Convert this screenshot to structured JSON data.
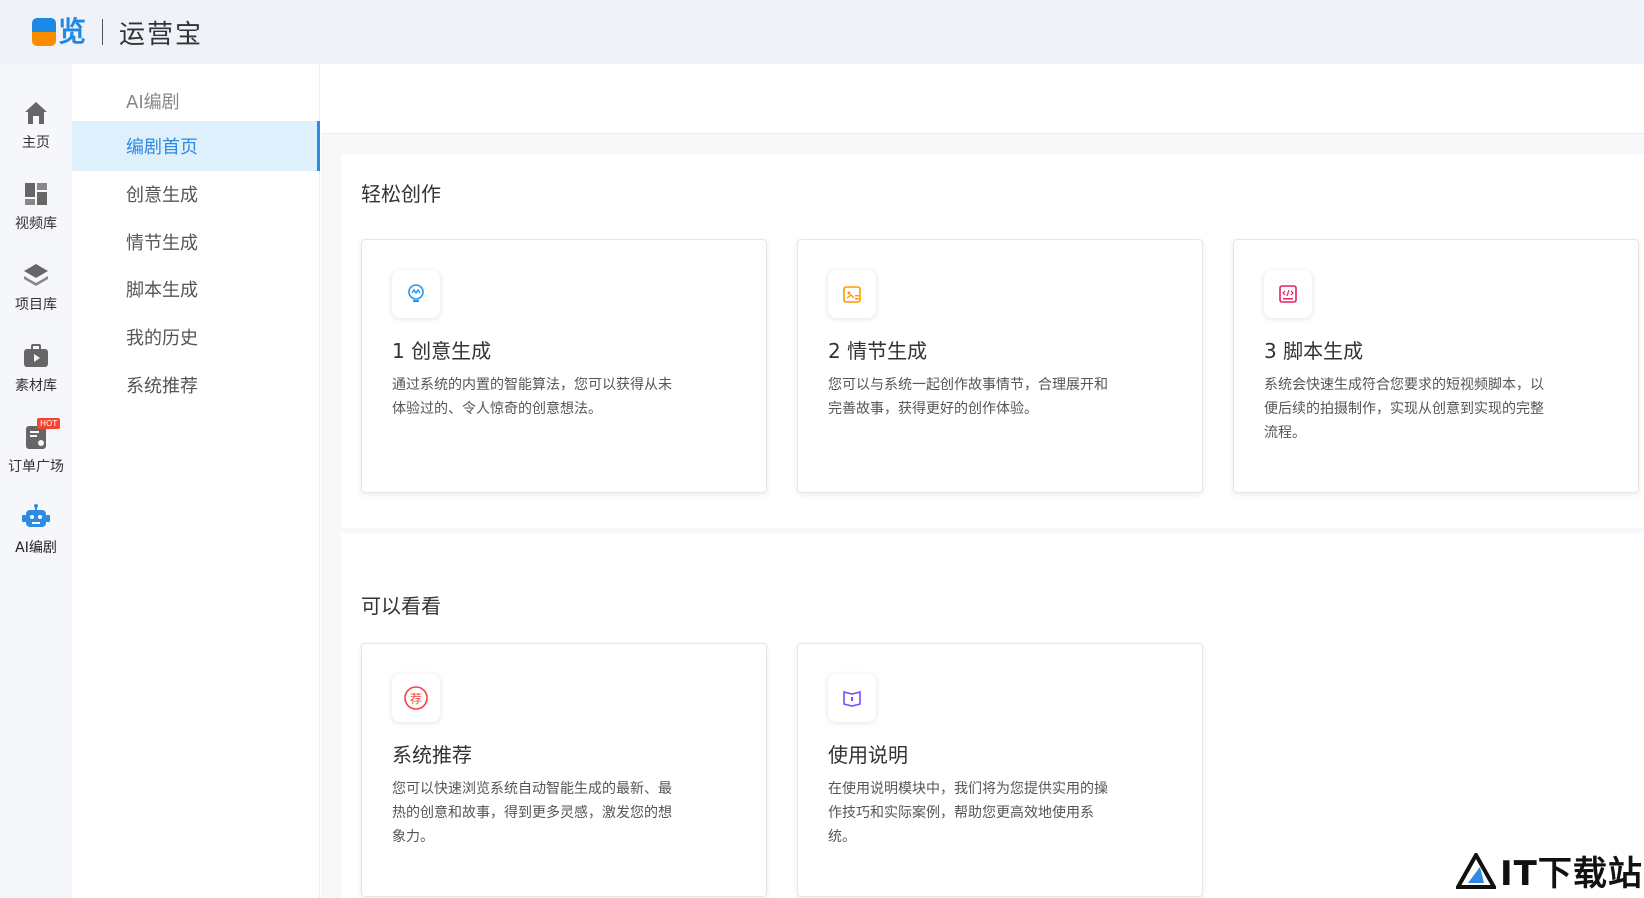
{
  "header": {
    "logo_char": "览",
    "brand": "运营宝"
  },
  "rail": [
    {
      "label": "主页",
      "icon": "home-icon"
    },
    {
      "label": "视频库",
      "icon": "layout-icon"
    },
    {
      "label": "项目库",
      "icon": "layers-icon"
    },
    {
      "label": "素材库",
      "icon": "briefcase-play-icon"
    },
    {
      "label": "订单广场",
      "icon": "order-icon",
      "badge": "HOT"
    },
    {
      "label": "AI编剧",
      "icon": "robot-icon",
      "active": true
    }
  ],
  "submenu": {
    "title": "AI编剧",
    "items": [
      {
        "label": "编剧首页",
        "active": true
      },
      {
        "label": "创意生成"
      },
      {
        "label": "情节生成"
      },
      {
        "label": "脚本生成"
      },
      {
        "label": "我的历史"
      },
      {
        "label": "系统推荐"
      }
    ]
  },
  "sections": [
    {
      "title": "轻松创作",
      "cards": [
        {
          "title": "1 创意生成",
          "desc": "通过系统的内置的智能算法，您可以获得从未体验过的、令人惊奇的创意想法。",
          "icon": "lightbulb-icon",
          "color": "#2196f3"
        },
        {
          "title": "2 情节生成",
          "desc": "您可以与系统一起创作故事情节，合理展开和完善故事，获得更好的创作体验。",
          "icon": "storyboard-icon",
          "color": "#ff9800"
        },
        {
          "title": "3 脚本生成",
          "desc": "系统会快速生成符合您要求的短视频脚本，以便后续的拍摄制作，实现从创意到实现的完整流程。",
          "icon": "code-script-icon",
          "color": "#e91e63"
        }
      ]
    },
    {
      "title": "可以看看",
      "cards": [
        {
          "title": "系统推荐",
          "desc": "您可以快速浏览系统自动智能生成的最新、最热的创意和故事，得到更多灵感，激发您的想象力。",
          "icon": "recommend-icon",
          "icon_char": "荐",
          "color": "#f44336"
        },
        {
          "title": "使用说明",
          "desc": "在使用说明模块中，我们将为您提供实用的操作技巧和实际案例，帮助您更高效地使用系统。",
          "icon": "book-icon",
          "color": "#7c4dff"
        }
      ]
    }
  ],
  "watermark": {
    "text": "IT下载站"
  }
}
